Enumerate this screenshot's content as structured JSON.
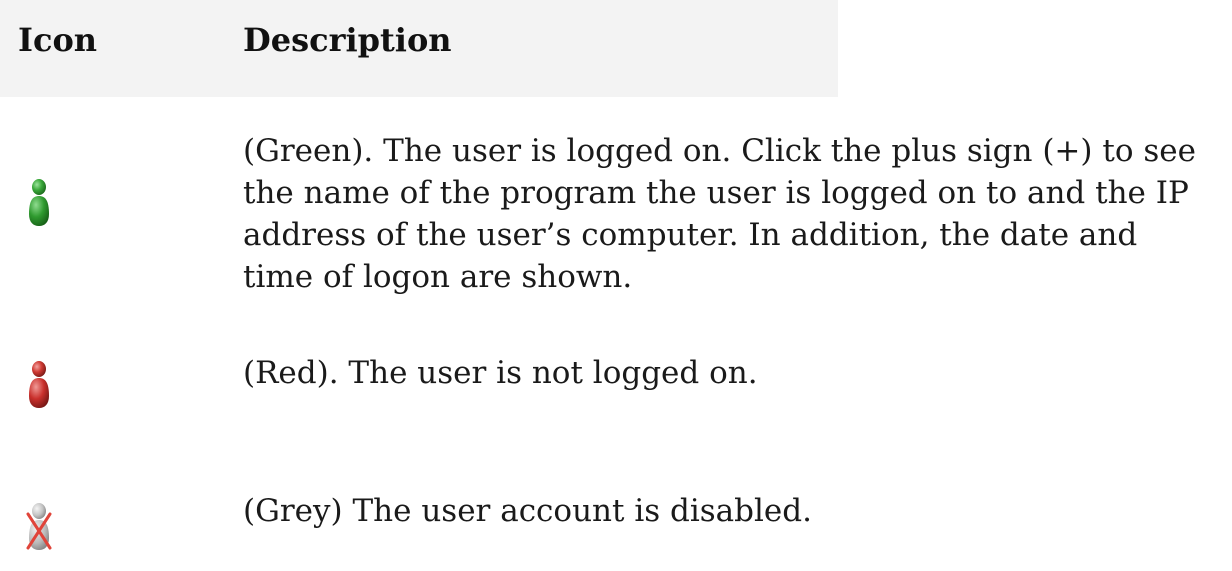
{
  "table": {
    "headers": {
      "icon": "Icon",
      "description": "Description"
    },
    "rows": [
      {
        "icon": "user-green-icon",
        "icon_color": "#2f9a2f",
        "lines": [
          "(Green). The user is logged on. Click the plus sign (+) to see",
          "the name of the program the user is logged on to and the IP",
          "address of the user’s computer. In addition, the date and",
          "time of logon are shown."
        ]
      },
      {
        "icon": "user-red-icon",
        "icon_color": "#c9302c",
        "lines": [
          "(Red). The user is not logged on."
        ]
      },
      {
        "icon": "user-grey-disabled-icon",
        "icon_color": "#b8b8b8",
        "cross_color": "#e0443a",
        "lines": [
          "(Grey) The user account is disabled."
        ]
      }
    ]
  },
  "colors": {
    "header_background": "#f3f3f3",
    "text": "#1a1a1a"
  }
}
